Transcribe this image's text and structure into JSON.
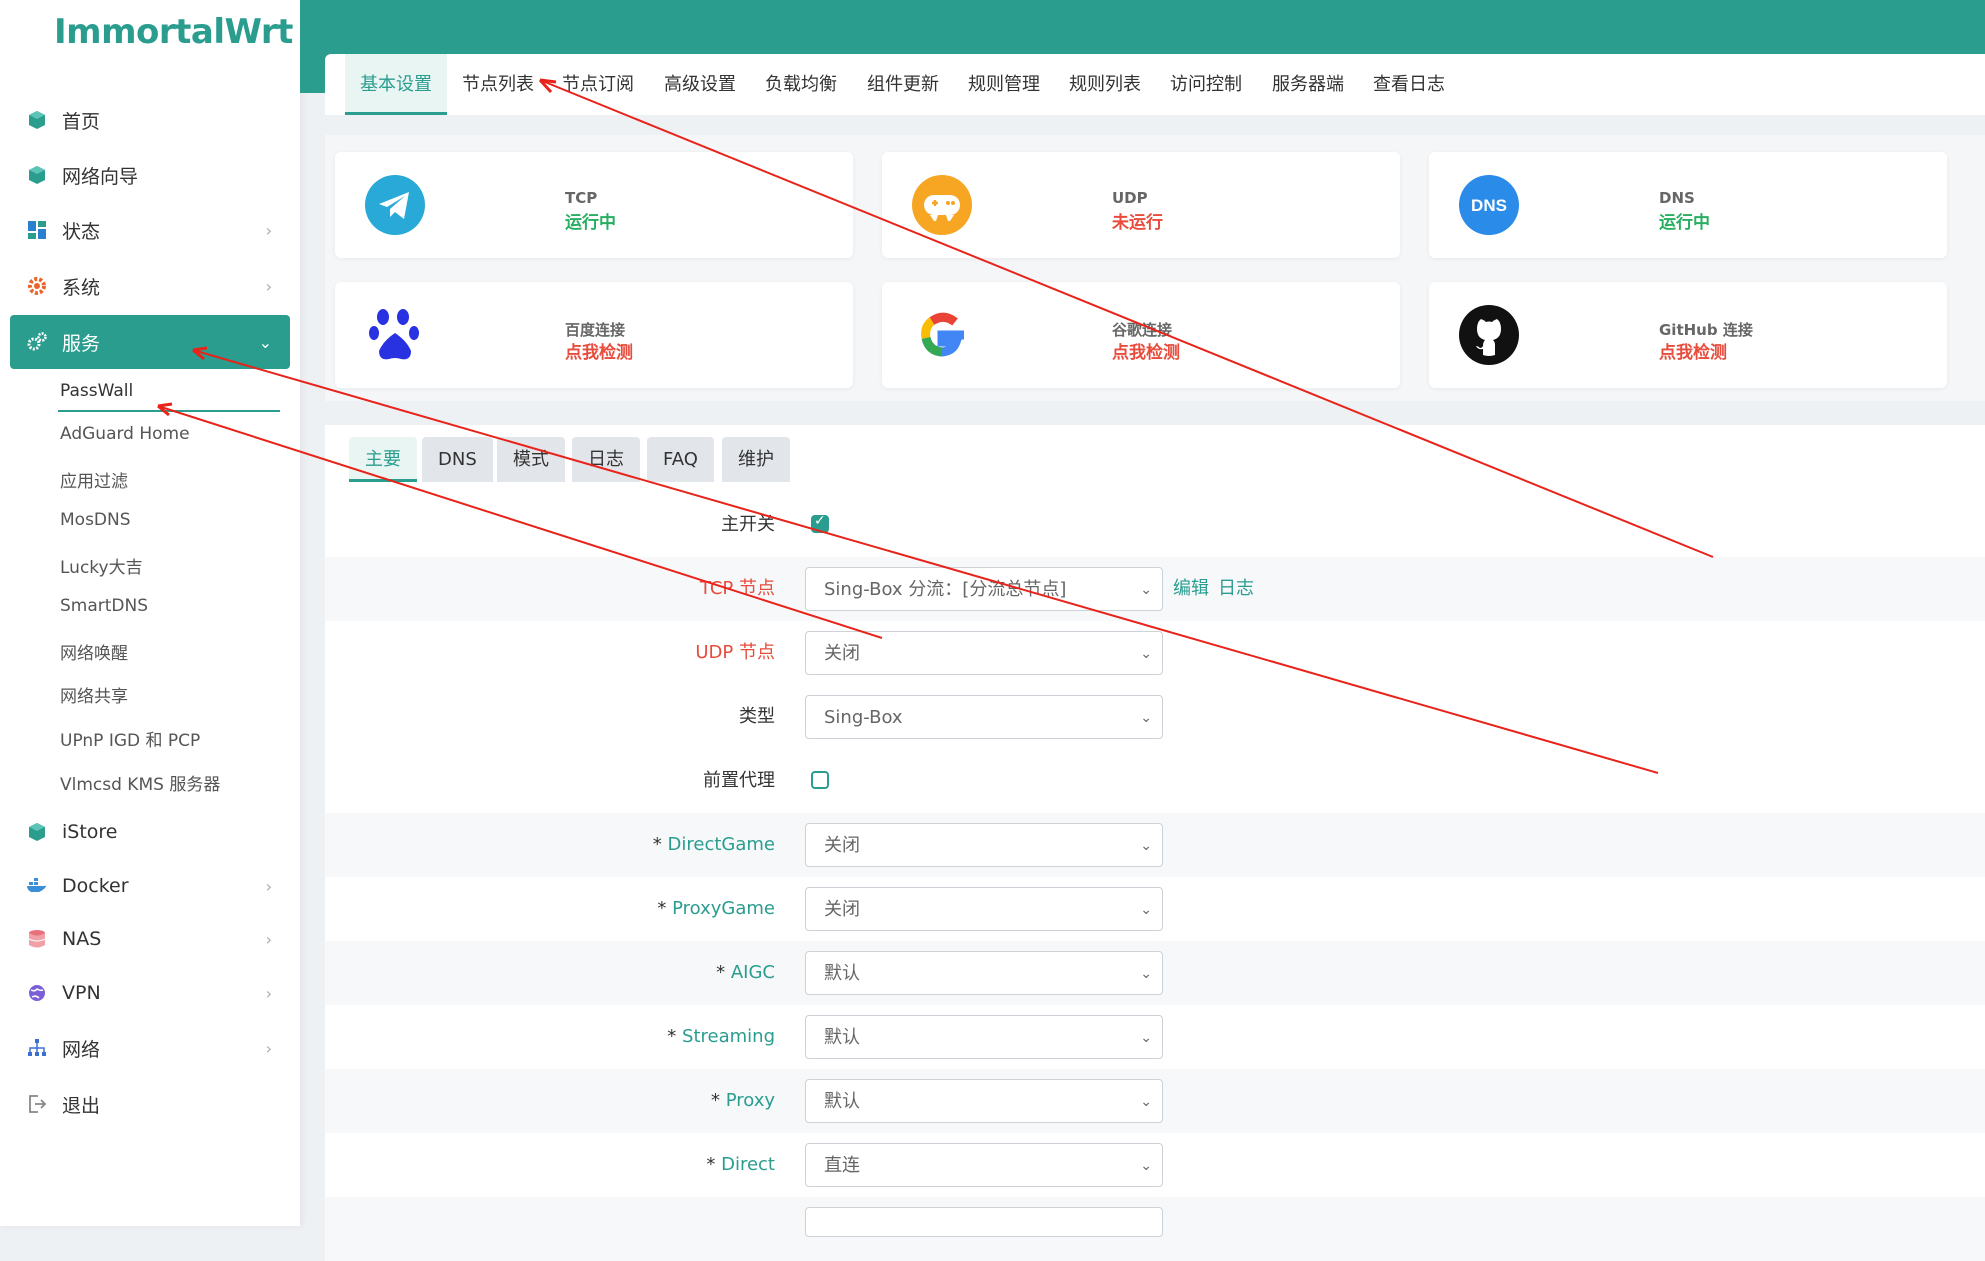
{
  "brand": "ImmortalWrt",
  "sidebar": {
    "items": [
      {
        "label": "首页",
        "icon": "cube-icon"
      },
      {
        "label": "网络向导",
        "icon": "cube-icon"
      },
      {
        "label": "状态",
        "icon": "dashboard-icon"
      },
      {
        "label": "系统",
        "icon": "gear-icon"
      },
      {
        "label": "服务",
        "icon": "gears-icon"
      },
      {
        "label": "iStore",
        "icon": "cube-icon"
      },
      {
        "label": "Docker",
        "icon": "docker-icon"
      },
      {
        "label": "NAS",
        "icon": "database-icon"
      },
      {
        "label": "VPN",
        "icon": "globe-icon"
      },
      {
        "label": "网络",
        "icon": "sitemap-icon"
      },
      {
        "label": "退出",
        "icon": "logout-icon"
      }
    ],
    "sub_items": [
      "PassWall",
      "AdGuard Home",
      "应用过滤",
      "MosDNS",
      "Lucky大吉",
      "SmartDNS",
      "网络唤醒",
      "网络共享",
      "UPnP IGD 和 PCP",
      "Vlmcsd KMS 服务器"
    ]
  },
  "tabs": [
    "基本设置",
    "节点列表",
    "节点订阅",
    "高级设置",
    "负载均衡",
    "组件更新",
    "规则管理",
    "规则列表",
    "访问控制",
    "服务器端",
    "查看日志"
  ],
  "cards": [
    {
      "title": "TCP",
      "status": "运行中",
      "icon": "telegram-icon"
    },
    {
      "title": "UDP",
      "status": "未运行",
      "icon": "gamepad-icon"
    },
    {
      "title": "DNS",
      "status": "运行中",
      "icon": "dns-icon",
      "icon_text": "DNS"
    },
    {
      "title": "百度连接",
      "status": "点我检测",
      "icon": "baidu-paw-icon"
    },
    {
      "title": "谷歌连接",
      "status": "点我检测",
      "icon": "google-icon"
    },
    {
      "title": "GitHub 连接",
      "status": "点我检测",
      "icon": "github-icon"
    }
  ],
  "subtabs": [
    "主要",
    "DNS",
    "模式",
    "日志",
    "FAQ",
    "维护"
  ],
  "settings": {
    "main_switch": "主开关",
    "tcp_node": {
      "label": "TCP 节点",
      "value": "Sing-Box 分流：[分流总节点]",
      "edit": "编辑",
      "log": "日志"
    },
    "udp_node": {
      "label": "UDP 节点",
      "value": "关闭"
    },
    "type": {
      "label": "类型",
      "value": "Sing-Box"
    },
    "pre_proxy": "前置代理",
    "rules": [
      {
        "label": "DirectGame",
        "value": "关闭"
      },
      {
        "label": "ProxyGame",
        "value": "关闭"
      },
      {
        "label": "AIGC",
        "value": "默认"
      },
      {
        "label": "Streaming",
        "value": "默认"
      },
      {
        "label": "Proxy",
        "value": "默认"
      },
      {
        "label": "Direct",
        "value": "直连"
      }
    ]
  },
  "colors": {
    "accent": "#2a9d8f",
    "running": "#27ae60",
    "stopped": "#e74c3c",
    "annotation": "#e8231a"
  }
}
